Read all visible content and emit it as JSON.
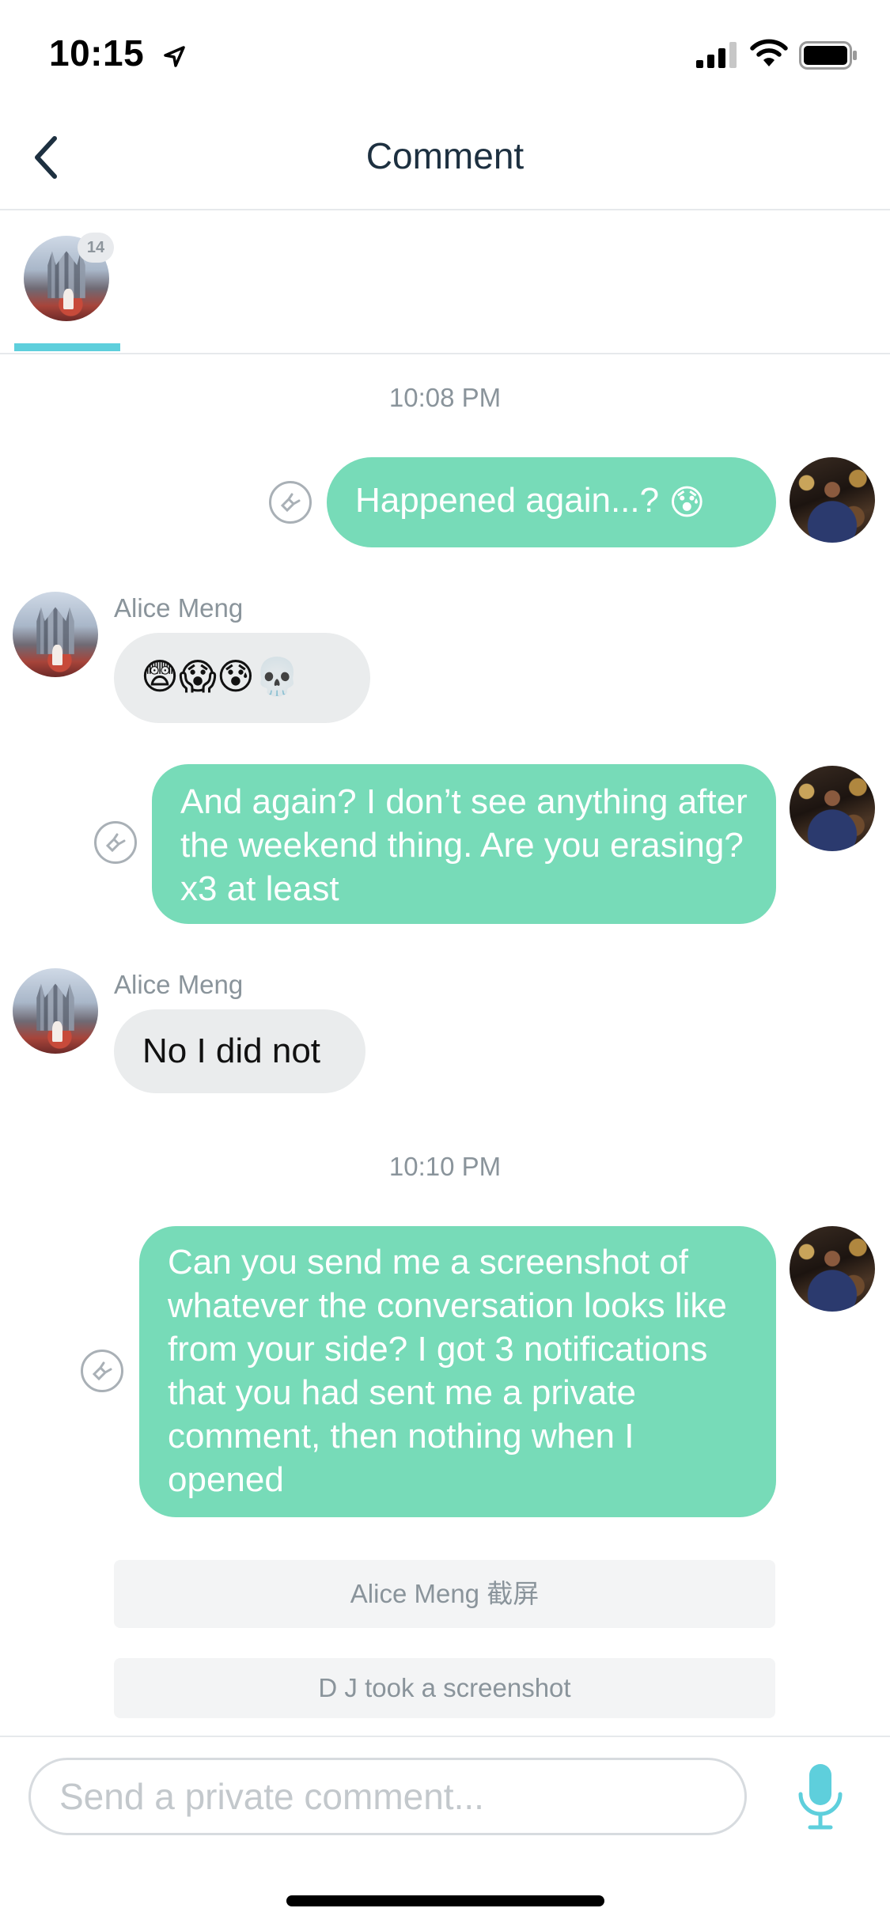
{
  "status_bar": {
    "time": "10:15",
    "icons": [
      "location-arrow-icon",
      "cellular-signal-icon",
      "wifi-icon",
      "battery-icon"
    ]
  },
  "nav": {
    "title": "Comment",
    "back_icon": "chevron-left-icon"
  },
  "conversation_tab": {
    "badge": "14"
  },
  "messages": {
    "t1": "10:08 PM",
    "m1": "Happened again...?",
    "m1_emoji": "😰",
    "m2_sender": "Alice Meng",
    "m2_emojis": "😨😱😰💀",
    "m3": "And again?  I don’t see anything after the weekend thing.  Are you erasing? x3 at least",
    "m4_sender": "Alice Meng",
    "m4": "No I did not",
    "t2": "10:10 PM",
    "m5": "Can you send me a screenshot of whatever the conversation looks like from your side?  I got 3 notifications that you had sent me a private comment, then nothing when I opened"
  },
  "notices": {
    "n1": "Alice Meng 截屏",
    "n2": "D J took a screenshot"
  },
  "composer": {
    "placeholder": "Send a private comment...",
    "mic_icon": "microphone-icon"
  },
  "colors": {
    "my_bubble": "#77dbb8",
    "their_bubble": "#eaeced",
    "accent": "#5ecfdc",
    "nav_title": "#1d3040"
  }
}
